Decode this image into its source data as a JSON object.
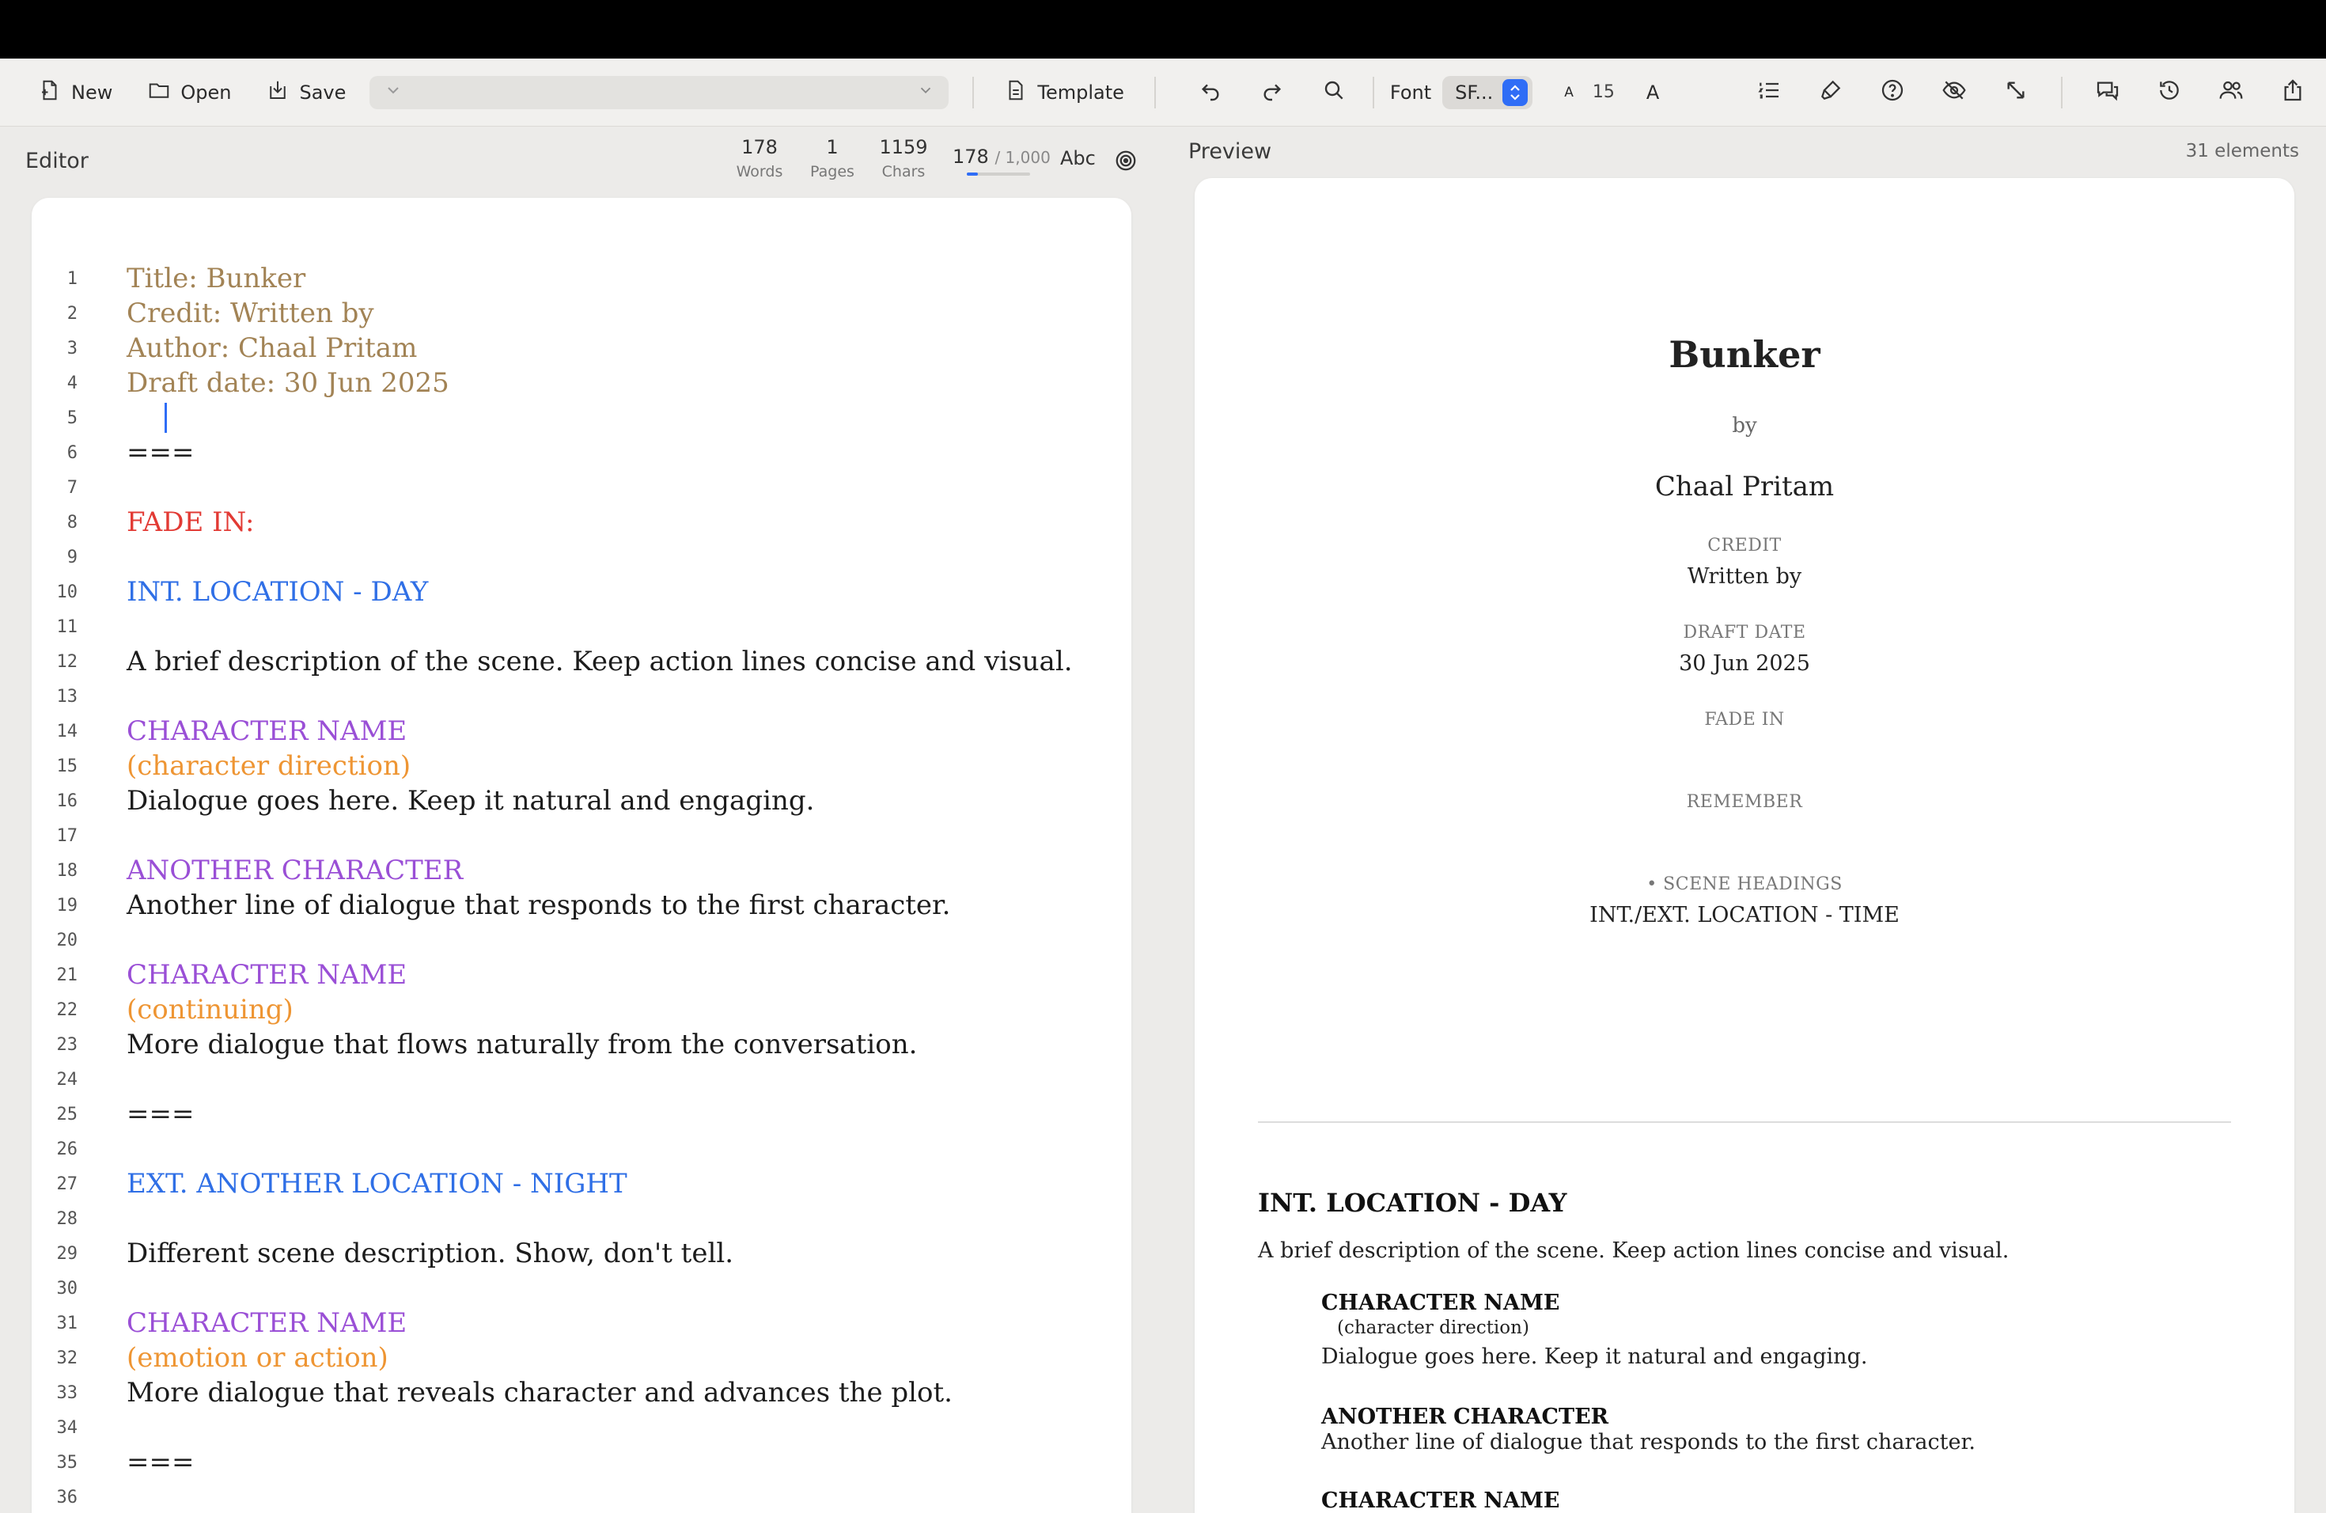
{
  "toolbar": {
    "new_label": "New",
    "open_label": "Open",
    "save_label": "Save",
    "template_label": "Template",
    "font_label": "Font",
    "font_value": "SF...",
    "small_a": "A",
    "font_size": "15",
    "big_a": "A"
  },
  "editor": {
    "title": "Editor",
    "stats": {
      "words": "178",
      "words_label": "Words",
      "pages": "1",
      "pages_label": "Pages",
      "chars": "1159",
      "chars_label": "Chars"
    },
    "goal": {
      "current": "178",
      "target": "/ 1,000",
      "progress": 0.178
    },
    "spell_label": "Abc",
    "lines": [
      {
        "n": "1",
        "text": "Title: Bunker",
        "type": "meta"
      },
      {
        "n": "2",
        "text": "Credit: Written by",
        "type": "meta"
      },
      {
        "n": "3",
        "text": "Author: Chaal Pritam",
        "type": "meta"
      },
      {
        "n": "4",
        "text": "Draft date: 30 Jun 2025",
        "type": "meta"
      },
      {
        "n": "5",
        "text": "",
        "type": "caret"
      },
      {
        "n": "6",
        "text": "===",
        "type": "sep"
      },
      {
        "n": "7",
        "text": "",
        "type": "blank"
      },
      {
        "n": "8",
        "text": "FADE IN:",
        "type": "trans"
      },
      {
        "n": "9",
        "text": "",
        "type": "blank"
      },
      {
        "n": "10",
        "text": "INT. LOCATION - DAY",
        "type": "scene"
      },
      {
        "n": "11",
        "text": "",
        "type": "blank"
      },
      {
        "n": "12",
        "text": "A brief description of the scene. Keep action lines concise and visual.",
        "type": "action"
      },
      {
        "n": "13",
        "text": "",
        "type": "blank"
      },
      {
        "n": "14",
        "text": "CHARACTER NAME",
        "type": "char"
      },
      {
        "n": "15",
        "text": "(character direction)",
        "type": "paren"
      },
      {
        "n": "16",
        "text": "Dialogue goes here. Keep it natural and engaging.",
        "type": "action"
      },
      {
        "n": "17",
        "text": "",
        "type": "blank"
      },
      {
        "n": "18",
        "text": "ANOTHER CHARACTER",
        "type": "char"
      },
      {
        "n": "19",
        "text": "Another line of dialogue that responds to the first character.",
        "type": "action"
      },
      {
        "n": "20",
        "text": "",
        "type": "blank"
      },
      {
        "n": "21",
        "text": "CHARACTER NAME",
        "type": "char"
      },
      {
        "n": "22",
        "text": "(continuing)",
        "type": "paren"
      },
      {
        "n": "23",
        "text": "More dialogue that flows naturally from the conversation.",
        "type": "action"
      },
      {
        "n": "24",
        "text": "",
        "type": "blank"
      },
      {
        "n": "25",
        "text": "===",
        "type": "sep"
      },
      {
        "n": "26",
        "text": "",
        "type": "blank"
      },
      {
        "n": "27",
        "text": "EXT. ANOTHER LOCATION - NIGHT",
        "type": "scene"
      },
      {
        "n": "28",
        "text": "",
        "type": "blank"
      },
      {
        "n": "29",
        "text": "Different scene description. Show, don't tell.",
        "type": "action"
      },
      {
        "n": "30",
        "text": "",
        "type": "blank"
      },
      {
        "n": "31",
        "text": "CHARACTER NAME",
        "type": "char"
      },
      {
        "n": "32",
        "text": "(emotion or action)",
        "type": "paren"
      },
      {
        "n": "33",
        "text": "More dialogue that reveals character and advances the plot.",
        "type": "action"
      },
      {
        "n": "34",
        "text": "",
        "type": "blank"
      },
      {
        "n": "35",
        "text": "===",
        "type": "sep"
      },
      {
        "n": "36",
        "text": "",
        "type": "blank"
      }
    ]
  },
  "preview": {
    "title": "Preview",
    "element_count": "31 elements",
    "title_page": {
      "title": "Bunker",
      "by": "by",
      "author": "Chaal Pritam",
      "credit_label": "CREDIT",
      "credit_value": "Written by",
      "draft_label": "DRAFT DATE",
      "draft_value": "30 Jun 2025",
      "fade_in": "FADE IN",
      "remember": "REMEMBER",
      "scene_headings_label": "• SCENE HEADINGS",
      "scene_headings_value": "INT./EXT. LOCATION - TIME"
    },
    "script": {
      "scene": "INT. LOCATION - DAY",
      "action": "A brief description of the scene. Keep action lines concise and visual.",
      "char1": "CHARACTER NAME",
      "paren1": "(character direction)",
      "dial1": "Dialogue goes here. Keep it natural and engaging.",
      "char2": "ANOTHER CHARACTER",
      "dial2": "Another line of dialogue that responds to the first character.",
      "char3": "CHARACTER NAME"
    }
  },
  "colors": {
    "accent": "#2f6df6",
    "meta": "#a28355",
    "transition": "#e23a34",
    "scene": "#2f6fe6",
    "character": "#9a4fd6",
    "parenthetical": "#ee9533"
  }
}
